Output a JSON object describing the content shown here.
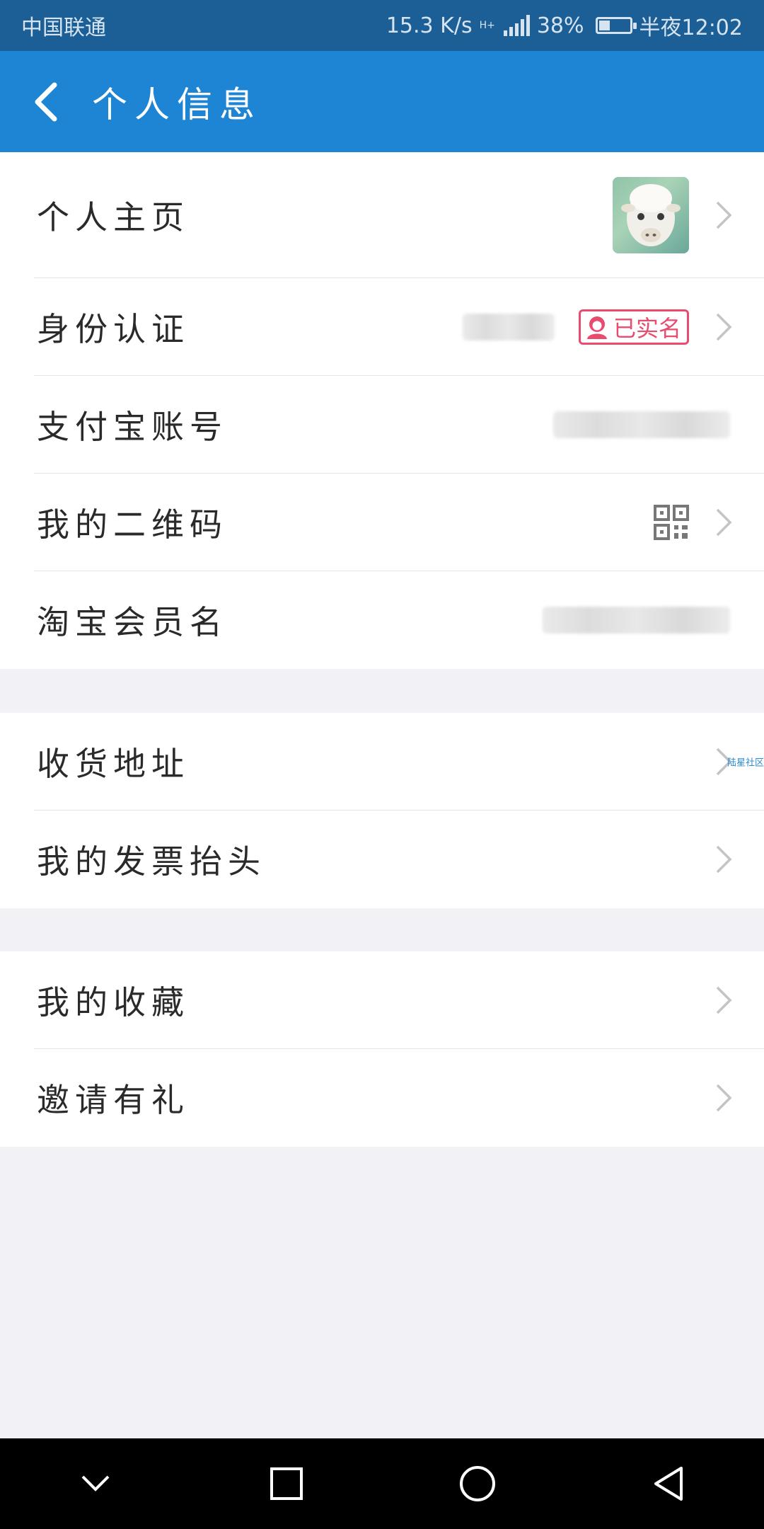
{
  "status": {
    "carrier": "中国联通",
    "speed": "15.3 K/s",
    "network": "H+",
    "battery": "38%",
    "battery_level": 0.38,
    "time": "半夜12:02"
  },
  "header": {
    "title": "个人信息"
  },
  "groups": [
    {
      "items": [
        {
          "label": "个人主页"
        },
        {
          "label": "身份认证",
          "badge": "已实名"
        },
        {
          "label": "支付宝账号"
        },
        {
          "label": "我的二维码"
        },
        {
          "label": "淘宝会员名"
        }
      ]
    },
    {
      "items": [
        {
          "label": "收货地址",
          "tag": "陆星社区"
        },
        {
          "label": "我的发票抬头"
        }
      ]
    },
    {
      "items": [
        {
          "label": "我的收藏"
        },
        {
          "label": "邀请有礼"
        }
      ]
    }
  ],
  "colors": {
    "status_bar": "#1c5e96",
    "app_bar": "#1e84d4",
    "badge": "#e74c6f",
    "background": "#f2f2f6"
  }
}
